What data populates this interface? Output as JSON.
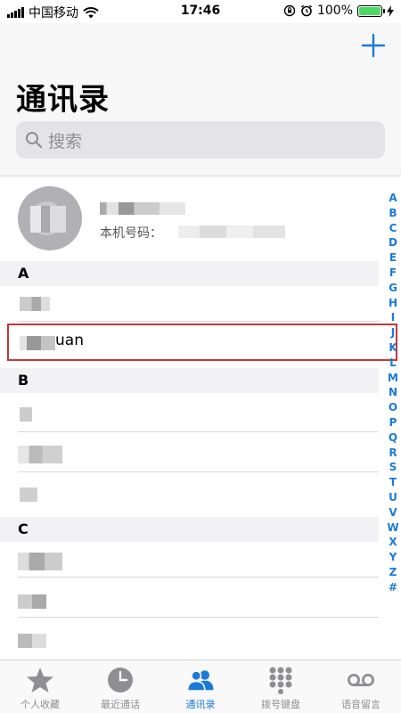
{
  "status_bar": {
    "carrier": "中国移动",
    "time": "17:46",
    "battery": "100%"
  },
  "header": {
    "title": "通讯录",
    "add_icon": "plus-icon",
    "search_placeholder": "搜索"
  },
  "my_card": {
    "number_label": "本机号码："
  },
  "sections": [
    {
      "letter": "A"
    },
    {
      "letter": "B"
    },
    {
      "letter": "C"
    }
  ],
  "contacts": {
    "highlighted_suffix": "uan"
  },
  "index": [
    "A",
    "B",
    "C",
    "D",
    "E",
    "F",
    "G",
    "H",
    "I",
    "J",
    "K",
    "L",
    "M",
    "N",
    "O",
    "P",
    "Q",
    "R",
    "S",
    "T",
    "U",
    "V",
    "W",
    "X",
    "Y",
    "Z",
    "#"
  ],
  "tabs": [
    {
      "label": "个人收藏",
      "icon": "star-icon"
    },
    {
      "label": "最近通话",
      "icon": "clock-icon"
    },
    {
      "label": "通讯录",
      "icon": "contacts-icon",
      "active": true
    },
    {
      "label": "拨号键盘",
      "icon": "keypad-icon"
    },
    {
      "label": "语音留言",
      "icon": "voicemail-icon"
    }
  ],
  "colors": {
    "accent": "#1a7ad9",
    "highlight_border": "#c0393b",
    "battery_fill": "#4cd964"
  }
}
